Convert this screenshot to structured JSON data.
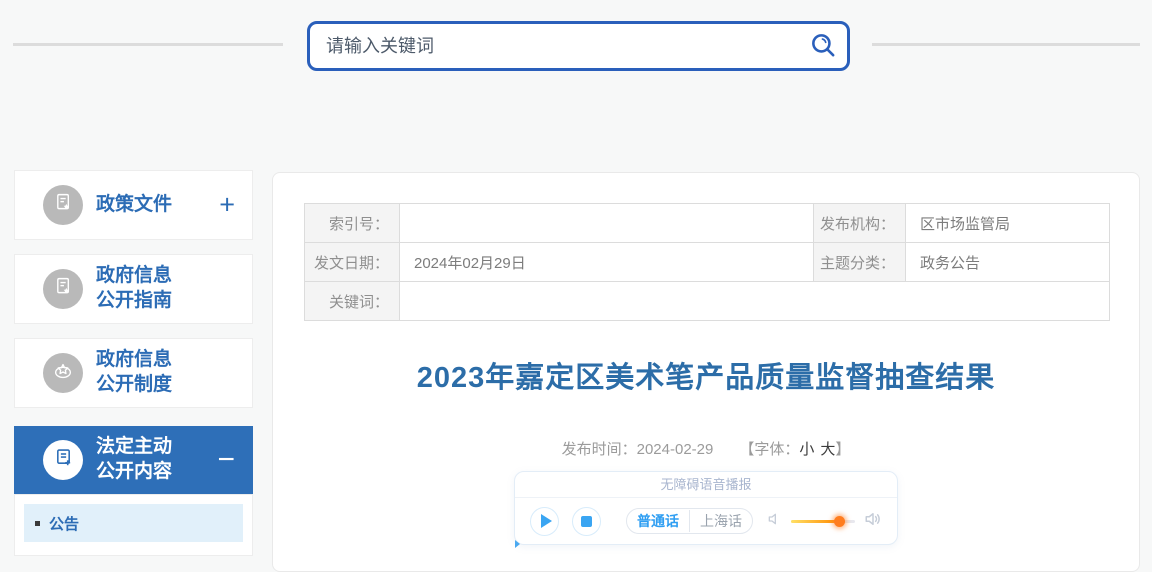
{
  "search": {
    "placeholder": "请输入关键词"
  },
  "sidebar": {
    "items": [
      {
        "line1": "政策文件",
        "line2": "",
        "toggle": "+",
        "icon": "document-star-icon",
        "active": false
      },
      {
        "line1": "政府信息",
        "line2": "公开指南",
        "toggle": "",
        "icon": "document-star-icon",
        "active": false
      },
      {
        "line1": "政府信息",
        "line2": "公开制度",
        "toggle": "",
        "icon": "award-star-icon",
        "active": false
      },
      {
        "line1": "法定主动",
        "line2": "公开内容",
        "toggle": "−",
        "icon": "document-plus-icon",
        "active": true
      }
    ],
    "submenu": {
      "label": "公告"
    }
  },
  "doc_meta": {
    "index_label": "索引号：",
    "index_value": "",
    "issuer_label": "发布机构：",
    "issuer_value": "区市场监管局",
    "date_label": "发文日期：",
    "date_value": "2024年02月29日",
    "category_label": "主题分类：",
    "category_value": "政务公告",
    "keywords_label": "关键词：",
    "keywords_value": ""
  },
  "article": {
    "title": "2023年嘉定区美术笔产品质量监督抽查结果",
    "publish_label": "发布时间：",
    "publish_date": "2024-02-29",
    "font_prefix": "【字体：",
    "font_small": "小",
    "font_large": "大",
    "font_suffix": "】"
  },
  "audio_player": {
    "header": "无障碍语音播报",
    "lang_options": [
      {
        "label": "普通话",
        "active": true
      },
      {
        "label": "上海话",
        "active": false
      }
    ],
    "volume_percent": 75
  },
  "colors": {
    "accent_blue": "#2e6fb8",
    "sidebar_text_blue": "#2c6cb5",
    "title_blue": "#2c6da8",
    "search_border_blue": "#2a5fbb",
    "player_blue": "#3aa5f2",
    "volume_orange": "#ff7d1f",
    "submenu_bg": "#e1f0fa"
  }
}
